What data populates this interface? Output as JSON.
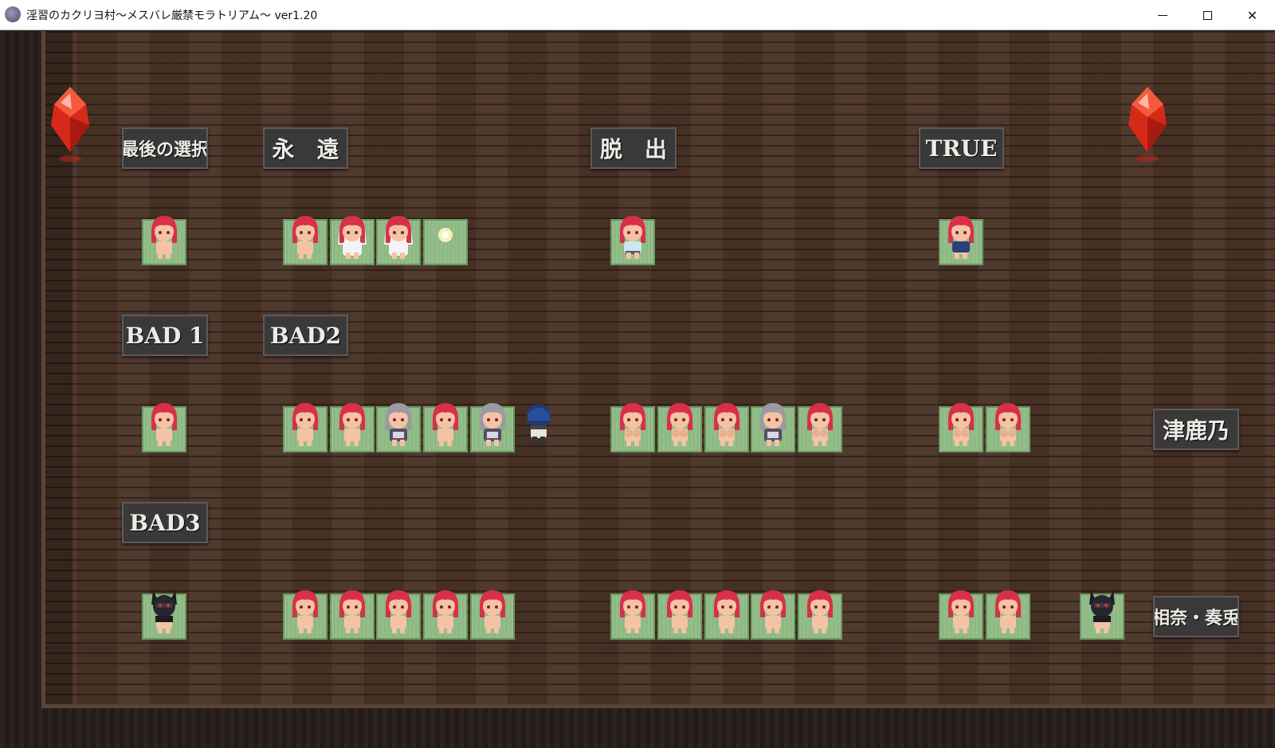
{
  "window": {
    "title": "淫習のカクリヨ村～メスバレ厳禁モラトリアム～ ver1.20",
    "app_icon": "game-app-icon",
    "minimize_glyph": "",
    "maximize_glyph": "",
    "close_glyph": "✕"
  },
  "signs": {
    "last_choice": "最後の選択",
    "eternity": "永　遠",
    "escape": "脱　出",
    "true_end": "TRUE",
    "bad1": "BAD 1",
    "bad2": "BAD2",
    "bad3": "BAD3",
    "tsurukano": "津鹿乃",
    "aina_kanato": "相奈・奏兎"
  },
  "colors": {
    "hair_red": "#d8304a",
    "skin": "#f4c3a4",
    "tatami": "#8db983",
    "floor": "#4a3326",
    "sign_bg": "#3a3838",
    "crystal": "#e5311e"
  },
  "icons": {
    "crystal": "red-crystal-icon",
    "player": "player-character-icon",
    "glow_orb": "glowing-orb-icon"
  }
}
